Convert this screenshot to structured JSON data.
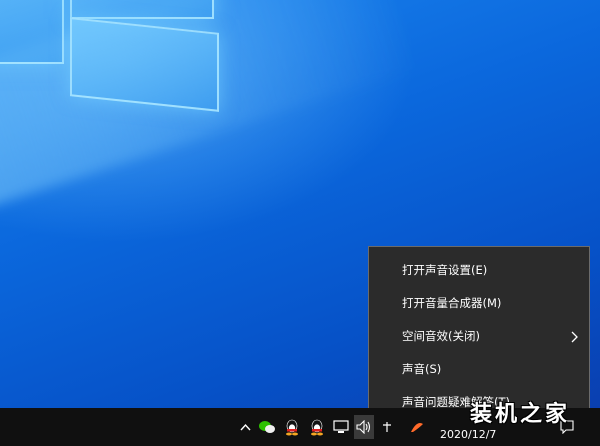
{
  "context_menu": {
    "items": [
      {
        "label": "打开声音设置(E)",
        "has_submenu": false
      },
      {
        "label": "打开音量合成器(M)",
        "has_submenu": false
      },
      {
        "label": "空间音效(关闭)",
        "has_submenu": true
      },
      {
        "label": "声音(S)",
        "has_submenu": false
      },
      {
        "label": "声音问题疑难解答(T)",
        "has_submenu": false
      }
    ]
  },
  "taskbar": {
    "tray_icons": [
      "chevron-up-icon",
      "wechat-icon",
      "qq-icon",
      "qq-icon",
      "network-icon",
      "volume-icon",
      "input-method-icon",
      "app-icon"
    ],
    "clock": {
      "time": "",
      "date": "2020/12/7"
    }
  },
  "watermark": {
    "text": "装机之家"
  },
  "colors": {
    "menu_bg": "#2b2b2b",
    "taskbar_bg": "#101010",
    "desktop_blue": "#0b68dd"
  }
}
